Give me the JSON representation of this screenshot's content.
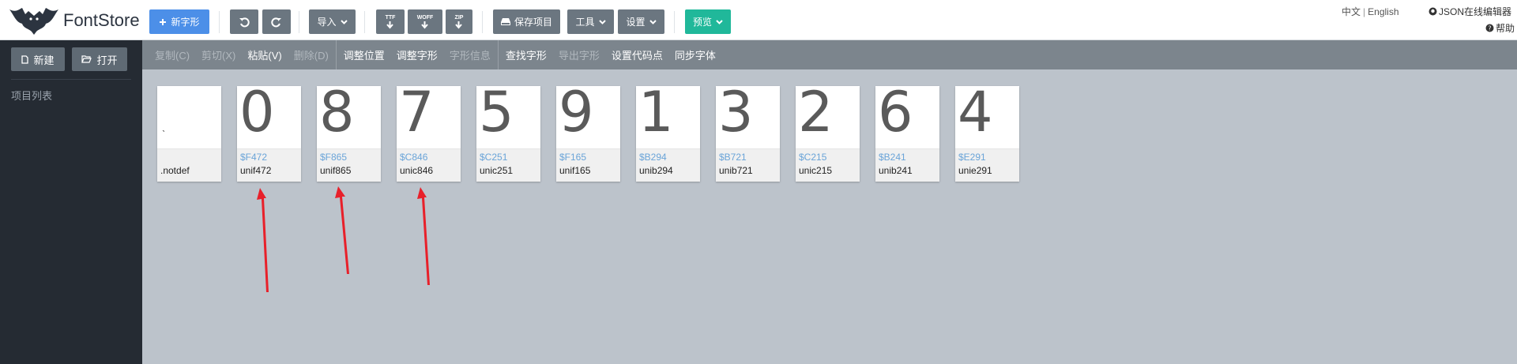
{
  "app": {
    "name": "FontStore"
  },
  "topbar": {
    "new_glyph": "新字形",
    "import": "导入",
    "export_ttf": "TTF",
    "export_woff": "WOFF",
    "export_zip": "ZIP",
    "save_project": "保存项目",
    "tools": "工具",
    "settings": "设置",
    "preview": "预览",
    "lang_zh": "中文",
    "lang_sep": "|",
    "lang_en": "English",
    "json_editor": "JSON在线编辑器",
    "help": "帮助"
  },
  "sidebar": {
    "new_label": "新建",
    "open_label": "打开",
    "project_list": "项目列表"
  },
  "toolbar": {
    "items": [
      {
        "label": "复制(C)",
        "enabled": false
      },
      {
        "label": "剪切(X)",
        "enabled": false
      },
      {
        "label": "粘贴(V)",
        "enabled": true
      },
      {
        "label": "删除(D)",
        "enabled": false
      },
      {
        "label": "调整位置",
        "enabled": true
      },
      {
        "label": "调整字形",
        "enabled": true
      },
      {
        "label": "字形信息",
        "enabled": false
      },
      {
        "label": "查找字形",
        "enabled": true
      },
      {
        "label": "导出字形",
        "enabled": false
      },
      {
        "label": "设置代码点",
        "enabled": true
      },
      {
        "label": "同步字体",
        "enabled": true
      }
    ]
  },
  "glyphs": [
    {
      "glyph": "",
      "code": "",
      "name": ".notdef"
    },
    {
      "glyph": "0",
      "code": "$F472",
      "name": "unif472"
    },
    {
      "glyph": "8",
      "code": "$F865",
      "name": "unif865"
    },
    {
      "glyph": "7",
      "code": "$C846",
      "name": "unic846"
    },
    {
      "glyph": "5",
      "code": "$C251",
      "name": "unic251"
    },
    {
      "glyph": "9",
      "code": "$F165",
      "name": "unif165"
    },
    {
      "glyph": "1",
      "code": "$B294",
      "name": "unib294"
    },
    {
      "glyph": "3",
      "code": "$B721",
      "name": "unib721"
    },
    {
      "glyph": "2",
      "code": "$C215",
      "name": "unic215"
    },
    {
      "glyph": "6",
      "code": "$B241",
      "name": "unib241"
    },
    {
      "glyph": "4",
      "code": "$E291",
      "name": "unie291"
    }
  ],
  "colors": {
    "primary": "#4c8fe8",
    "preview": "#20b89a",
    "sidebar": "#252b33",
    "toolbar": "#7c858d",
    "annotation_arrow": "#e8202a"
  }
}
